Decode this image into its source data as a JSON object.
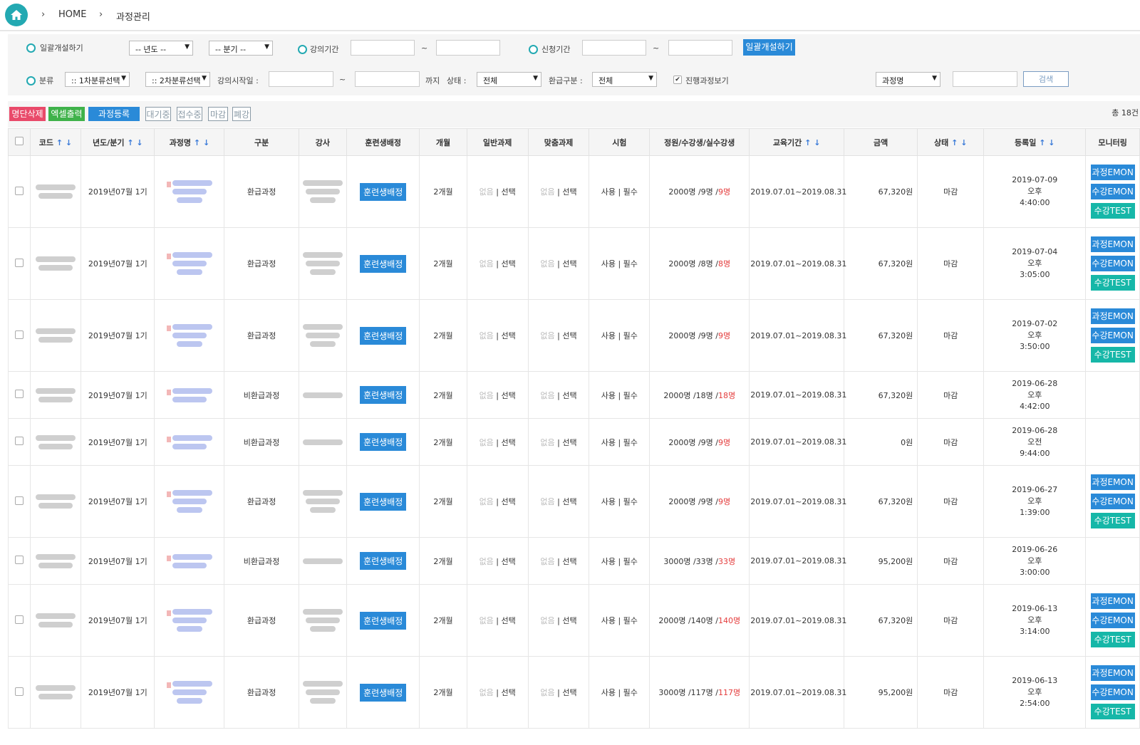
{
  "breadcrumb": {
    "home": "HOME",
    "current": "과정관리"
  },
  "filters": {
    "bulk_open_label": "일괄개설하기",
    "year_select": "-- 년도 --",
    "quarter_select": "-- 분기 --",
    "lecture_period_label": "강의기간",
    "tilde": "~",
    "apply_period_label": "신청기간",
    "bulk_open_button": "일괄개설하기",
    "category_label": "분류",
    "category1_select": ":: 1차분류선택",
    "category2_select": ":: 2차분류선택",
    "lecture_start_label": "강의시작일 :",
    "until_label": "까지",
    "status_label": "상태 :",
    "status_select": "전체",
    "refund_label": "환급구분 :",
    "refund_select": "전체",
    "in_progress_label": "진행과정보기",
    "in_progress_checked": "✔",
    "search_field_select": "과정명",
    "search_button": "검색"
  },
  "toolbar": {
    "delete_list": "명단삭제",
    "excel_export": "엑셀출력",
    "course_register": "과정등록",
    "status_waiting": "대기중",
    "status_accepting": "접수중",
    "status_closed": "마감",
    "status_closed_course": "폐강",
    "total_count": "총 18건"
  },
  "table": {
    "headers": {
      "code": "코드",
      "year_quarter": "년도/분기",
      "course_name": "과정명",
      "category": "구분",
      "instructor": "강사",
      "trainee_assign": "훈련생배정",
      "months": "개월",
      "general_task": "일반과제",
      "custom_task": "맞춤과제",
      "exam": "시험",
      "enrollment": "정원/수강생/실수강생",
      "edu_period": "교육기간",
      "amount": "금액",
      "status": "상태",
      "reg_date": "등록일",
      "monitoring": "모니터링"
    },
    "sort_up": "↑",
    "sort_down": "↓",
    "rows": [
      {
        "year": "2019년07월 1기",
        "category": "환급과정",
        "assign": "훈련생배정",
        "months": "2개월",
        "none": "없음",
        "sep": " | ",
        "select": "선택",
        "exam_use": "사용",
        "exam_req": "필수",
        "enroll_prefix": "2000명 /9명 /",
        "enroll_actual": "9명",
        "period": "2019.07.01~2019.08.31",
        "amount": "67,320원",
        "status": "마감",
        "date": "2019-07-09",
        "ampm": "오후",
        "time": "4:40:00",
        "mon": [
          "과정EMON",
          "수강EMON",
          "수강TEST"
        ]
      },
      {
        "year": "2019년07월 1기",
        "category": "환급과정",
        "assign": "훈련생배정",
        "months": "2개월",
        "none": "없음",
        "sep": " | ",
        "select": "선택",
        "exam_use": "사용",
        "exam_req": "필수",
        "enroll_prefix": "2000명 /8명 /",
        "enroll_actual": "8명",
        "period": "2019.07.01~2019.08.31",
        "amount": "67,320원",
        "status": "마감",
        "date": "2019-07-04",
        "ampm": "오후",
        "time": "3:05:00",
        "mon": [
          "과정EMON",
          "수강EMON",
          "수강TEST"
        ]
      },
      {
        "year": "2019년07월 1기",
        "category": "환급과정",
        "assign": "훈련생배정",
        "months": "2개월",
        "none": "없음",
        "sep": " | ",
        "select": "선택",
        "exam_use": "사용",
        "exam_req": "필수",
        "enroll_prefix": "2000명 /9명 /",
        "enroll_actual": "9명",
        "period": "2019.07.01~2019.08.31",
        "amount": "67,320원",
        "status": "마감",
        "date": "2019-07-02",
        "ampm": "오후",
        "time": "3:50:00",
        "mon": [
          "과정EMON",
          "수강EMON",
          "수강TEST"
        ]
      },
      {
        "year": "2019년07월 1기",
        "category": "비환급과정",
        "assign": "훈련생배정",
        "months": "2개월",
        "none": "없음",
        "sep": " | ",
        "select": "선택",
        "exam_use": "사용",
        "exam_req": "필수",
        "enroll_prefix": "2000명 /18명 /",
        "enroll_actual": "18명",
        "period": "2019.07.01~2019.08.31",
        "amount": "67,320원",
        "status": "마감",
        "date": "2019-06-28",
        "ampm": "오후",
        "time": "4:42:00",
        "mon": []
      },
      {
        "year": "2019년07월 1기",
        "category": "비환급과정",
        "assign": "훈련생배정",
        "months": "2개월",
        "none": "없음",
        "sep": " | ",
        "select": "선택",
        "exam_use": "사용",
        "exam_req": "필수",
        "enroll_prefix": "2000명 /9명 /",
        "enroll_actual": "9명",
        "period": "2019.07.01~2019.08.31",
        "amount": "0원",
        "status": "마감",
        "date": "2019-06-28",
        "ampm": "오전",
        "time": "9:44:00",
        "mon": []
      },
      {
        "year": "2019년07월 1기",
        "category": "환급과정",
        "assign": "훈련생배정",
        "months": "2개월",
        "none": "없음",
        "sep": " | ",
        "select": "선택",
        "exam_use": "사용",
        "exam_req": "필수",
        "enroll_prefix": "2000명 /9명 /",
        "enroll_actual": "9명",
        "period": "2019.07.01~2019.08.31",
        "amount": "67,320원",
        "status": "마감",
        "date": "2019-06-27",
        "ampm": "오후",
        "time": "1:39:00",
        "mon": [
          "과정EMON",
          "수강EMON",
          "수강TEST"
        ]
      },
      {
        "year": "2019년07월 1기",
        "category": "비환급과정",
        "assign": "훈련생배정",
        "months": "2개월",
        "none": "없음",
        "sep": " | ",
        "select": "선택",
        "exam_use": "사용",
        "exam_req": "필수",
        "enroll_prefix": "3000명 /33명 /",
        "enroll_actual": "33명",
        "period": "2019.07.01~2019.08.31",
        "amount": "95,200원",
        "status": "마감",
        "date": "2019-06-26",
        "ampm": "오후",
        "time": "3:00:00",
        "mon": []
      },
      {
        "year": "2019년07월 1기",
        "category": "환급과정",
        "assign": "훈련생배정",
        "months": "2개월",
        "none": "없음",
        "sep": " | ",
        "select": "선택",
        "exam_use": "사용",
        "exam_req": "필수",
        "enroll_prefix": "2000명 /140명 /",
        "enroll_actual": "140명",
        "period": "2019.07.01~2019.08.31",
        "amount": "67,320원",
        "status": "마감",
        "date": "2019-06-13",
        "ampm": "오후",
        "time": "3:14:00",
        "mon": [
          "과정EMON",
          "수강EMON",
          "수강TEST"
        ]
      },
      {
        "year": "2019년07월 1기",
        "category": "환급과정",
        "assign": "훈련생배정",
        "months": "2개월",
        "none": "없음",
        "sep": " | ",
        "select": "선택",
        "exam_use": "사용",
        "exam_req": "필수",
        "enroll_prefix": "3000명 /117명 /",
        "enroll_actual": "117명",
        "period": "2019.07.01~2019.08.31",
        "amount": "95,200원",
        "status": "마감",
        "date": "2019-06-13",
        "ampm": "오후",
        "time": "2:54:00",
        "mon": [
          "과정EMON",
          "수강EMON",
          "수강TEST"
        ]
      }
    ]
  }
}
